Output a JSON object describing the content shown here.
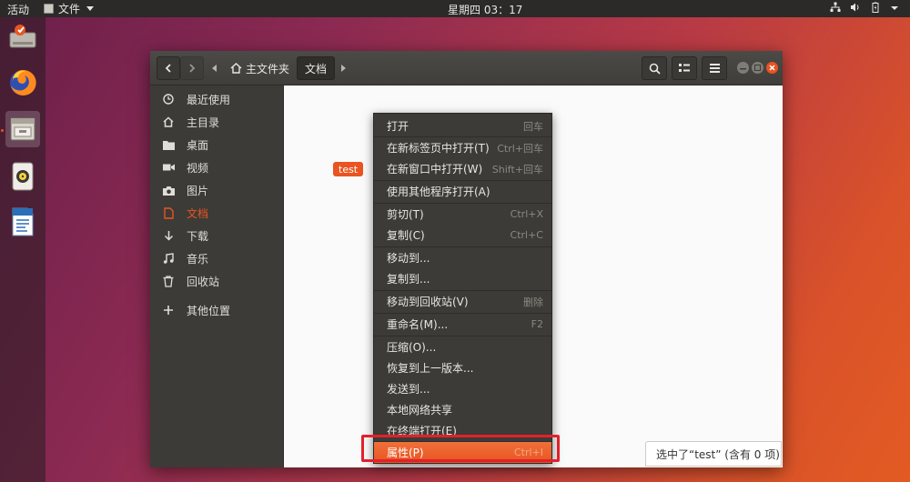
{
  "topbar": {
    "activities": "活动",
    "app_menu": "文件",
    "clock": "星期四 03：17"
  },
  "launcher": {
    "items": [
      "installer-icon",
      "firefox-icon",
      "files-icon",
      "rhythmbox-icon",
      "writer-icon"
    ]
  },
  "window": {
    "breadcrumbs": [
      "主文件夹",
      "文档"
    ]
  },
  "sidebar": {
    "items": [
      {
        "label": "最近使用",
        "icon": "clock-icon"
      },
      {
        "label": "主目录",
        "icon": "home-icon"
      },
      {
        "label": "桌面",
        "icon": "folder-icon"
      },
      {
        "label": "视频",
        "icon": "video-icon"
      },
      {
        "label": "图片",
        "icon": "camera-icon"
      },
      {
        "label": "文档",
        "icon": "document-icon"
      },
      {
        "label": "下载",
        "icon": "download-icon"
      },
      {
        "label": "音乐",
        "icon": "music-icon"
      },
      {
        "label": "回收站",
        "icon": "trash-icon"
      },
      {
        "label": "其他位置",
        "icon": "plus-icon"
      }
    ],
    "active_index": 5
  },
  "content": {
    "folder_name": "test"
  },
  "context_menu": {
    "items": [
      {
        "label": "打开",
        "accel": "回车"
      },
      {
        "label": "在新标签页中打开(T)",
        "accel": "Ctrl+回车"
      },
      {
        "label": "在新窗口中打开(W)",
        "accel": "Shift+回车"
      },
      {
        "label": "使用其他程序打开(A)",
        "accel": ""
      },
      {
        "label": "剪切(T)",
        "accel": "Ctrl+X"
      },
      {
        "label": "复制(C)",
        "accel": "Ctrl+C"
      },
      {
        "label": "移动到...",
        "accel": ""
      },
      {
        "label": "复制到...",
        "accel": ""
      },
      {
        "label": "移动到回收站(V)",
        "accel": "删除"
      },
      {
        "label": "重命名(M)...",
        "accel": "F2"
      },
      {
        "label": "压缩(O)...",
        "accel": ""
      },
      {
        "label": "恢复到上一版本...",
        "accel": ""
      },
      {
        "label": "发送到...",
        "accel": ""
      },
      {
        "label": "本地网络共享",
        "accel": ""
      },
      {
        "label": "在终端打开(E)",
        "accel": ""
      },
      {
        "label": "属性(P)",
        "accel": "Ctrl+I"
      }
    ],
    "highlighted_index": 15
  },
  "statusbar": {
    "text": "选中了“test” (含有 0 项)"
  },
  "colors": {
    "accent": "#e95420",
    "annotation_box": "#e3202b"
  }
}
